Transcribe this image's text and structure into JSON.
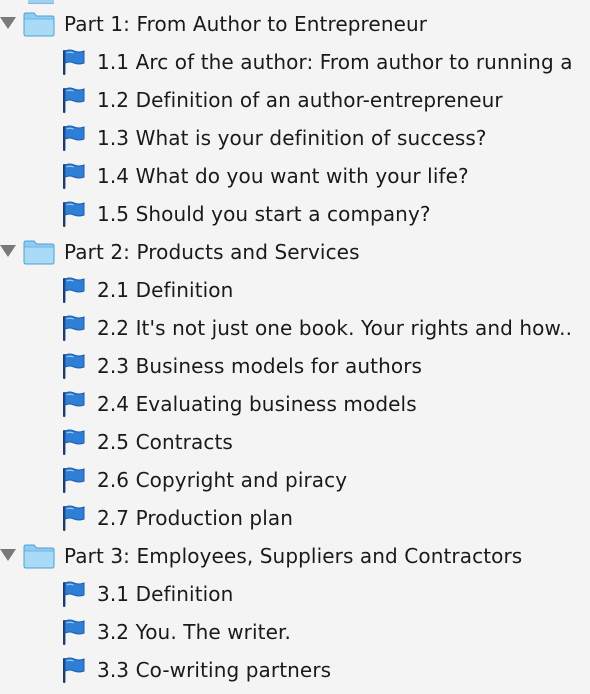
{
  "outline": {
    "parts": [
      {
        "title": "Part 1: From Author to Entrepreneur",
        "icon": "folder-icon",
        "expanded": true,
        "items": [
          {
            "title": "1.1 Arc of the author: From author to running a",
            "icon": "flag-icon"
          },
          {
            "title": "1.2 Definition of an author-entrepreneur",
            "icon": "flag-icon"
          },
          {
            "title": "1.3 What is your definition of success?",
            "icon": "flag-icon"
          },
          {
            "title": "1.4 What do you want with your life?",
            "icon": "flag-icon"
          },
          {
            "title": "1.5 Should you start a company?",
            "icon": "flag-icon"
          }
        ]
      },
      {
        "title": "Part 2: Products and Services",
        "icon": "folder-icon",
        "expanded": true,
        "items": [
          {
            "title": "2.1 Definition",
            "icon": "flag-icon"
          },
          {
            "title": "2.2 It's not just one book. Your rights and how..",
            "icon": "flag-icon"
          },
          {
            "title": "2.3 Business models for authors",
            "icon": "flag-icon"
          },
          {
            "title": "2.4 Evaluating business models",
            "icon": "flag-icon"
          },
          {
            "title": "2.5 Contracts",
            "icon": "flag-icon"
          },
          {
            "title": "2.6 Copyright and piracy",
            "icon": "flag-icon"
          },
          {
            "title": "2.7 Production plan",
            "icon": "flag-icon"
          }
        ]
      },
      {
        "title": "Part 3: Employees, Suppliers and Contractors",
        "icon": "folder-icon",
        "expanded": true,
        "items": [
          {
            "title": "3.1 Definition",
            "icon": "flag-icon"
          },
          {
            "title": "3.2 You. The writer.",
            "icon": "flag-icon"
          },
          {
            "title": "3.3 Co-writing partners",
            "icon": "flag-icon"
          }
        ]
      }
    ]
  },
  "colors": {
    "background": "#f4f4f4",
    "folder": "#8ecdf2",
    "flag": "#2f7fd6",
    "disclosure_triangle": "#7a7a7a",
    "text": "#1a1a1a"
  }
}
